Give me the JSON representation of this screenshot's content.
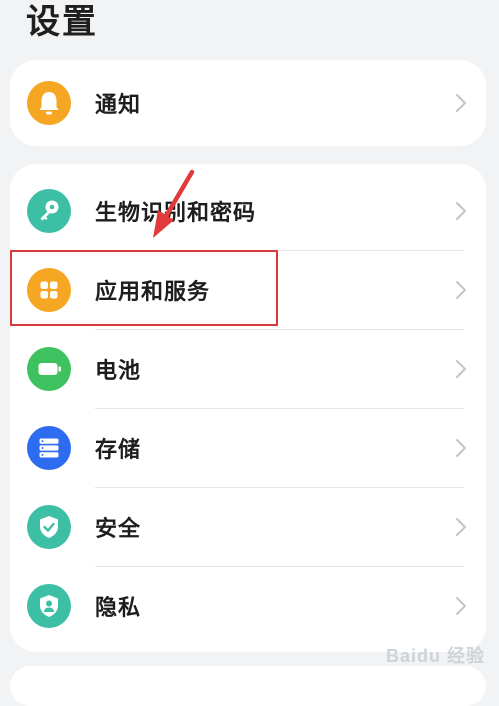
{
  "page": {
    "title": "设置"
  },
  "groups": [
    {
      "items": [
        {
          "label": "通知",
          "icon": "bell-icon",
          "color": "#f5a623"
        }
      ]
    },
    {
      "items": [
        {
          "label": "生物识别和密码",
          "icon": "key-icon",
          "color": "#3dbfa5"
        },
        {
          "label": "应用和服务",
          "icon": "apps-grid-icon",
          "color": "#f5a623"
        },
        {
          "label": "电池",
          "icon": "battery-icon",
          "color": "#3ec260"
        },
        {
          "label": "存储",
          "icon": "storage-icon",
          "color": "#2d6cf0"
        },
        {
          "label": "安全",
          "icon": "shield-check-icon",
          "color": "#3dbfa5"
        },
        {
          "label": "隐私",
          "icon": "privacy-shield-icon",
          "color": "#3dbfa5"
        }
      ]
    }
  ],
  "annotation": {
    "highlight_color": "#d93b3b"
  },
  "watermark": {
    "text": "Baidu 经验"
  }
}
